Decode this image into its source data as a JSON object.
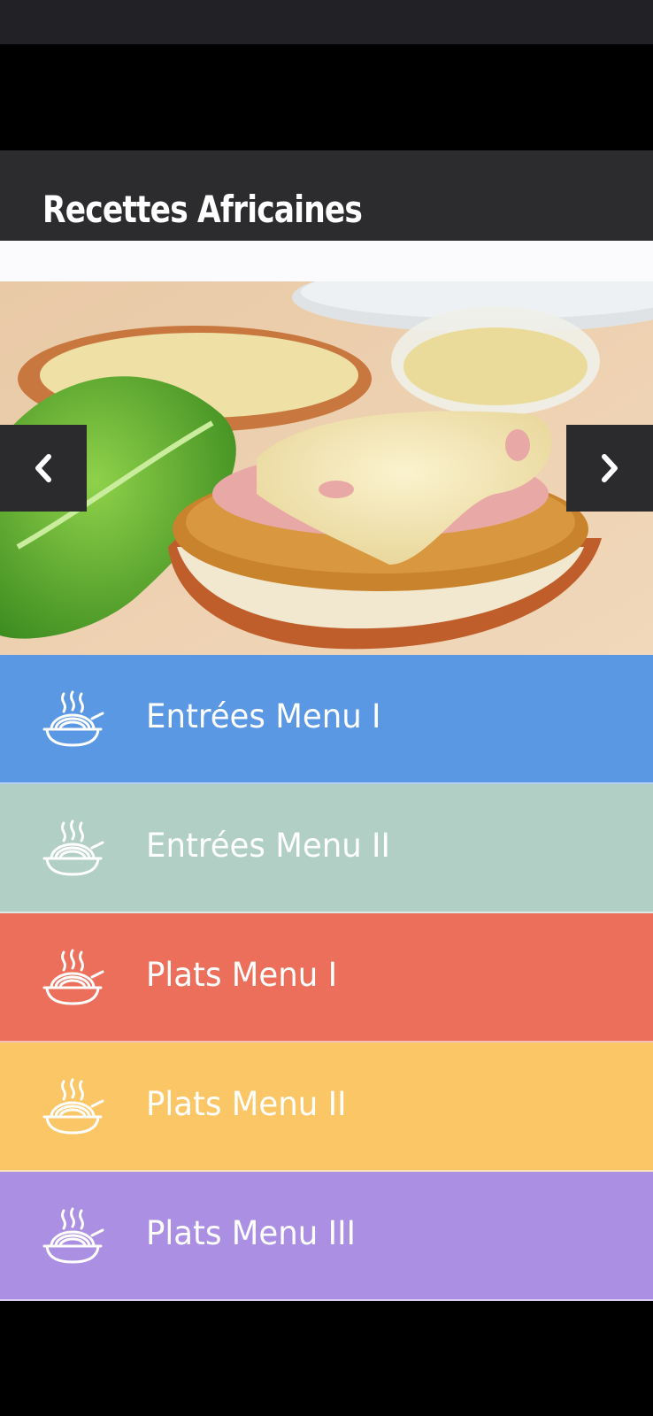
{
  "app": {
    "title": "Recettes Africaines"
  },
  "slider": {
    "image": "food-sandwich-photo",
    "prev_icon": "chevron-left-icon",
    "next_icon": "chevron-right-icon"
  },
  "menu": {
    "items": [
      {
        "label": "Entrées Menu I",
        "color": "#5b98e3",
        "icon": "food-bowl-icon"
      },
      {
        "label": "Entrées Menu II",
        "color": "#b1cfc5",
        "icon": "food-bowl-icon"
      },
      {
        "label": "Plats Menu I",
        "color": "#ec6f5c",
        "icon": "food-bowl-icon"
      },
      {
        "label": "Plats Menu II",
        "color": "#fbc665",
        "icon": "food-bowl-icon"
      },
      {
        "label": "Plats Menu III",
        "color": "#ab8fe3",
        "icon": "food-bowl-icon"
      }
    ]
  }
}
